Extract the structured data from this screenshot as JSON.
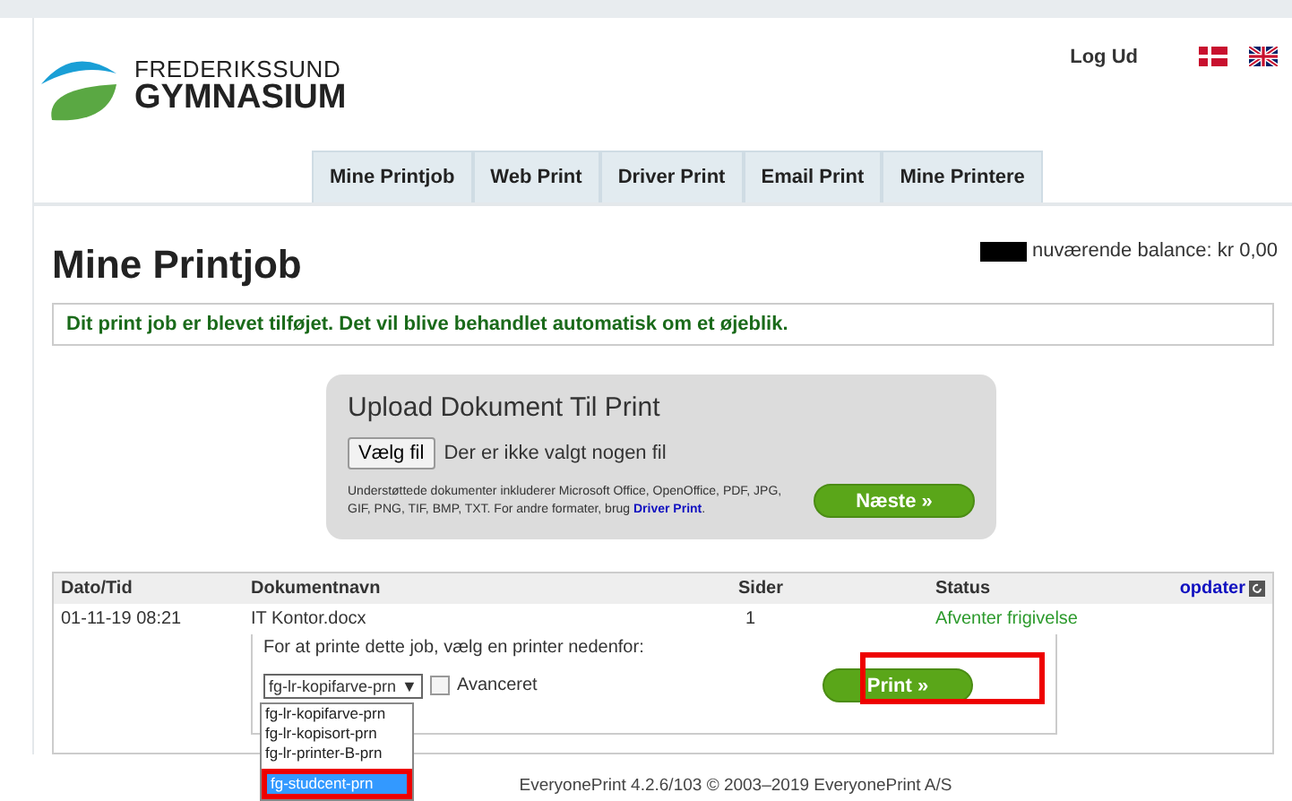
{
  "header": {
    "logo_line_1": "FREDERIKSSUND",
    "logo_line_2": "GYMNASIUM",
    "logout": "Log Ud"
  },
  "tabs": [
    {
      "label": "Mine Printjob"
    },
    {
      "label": "Web Print"
    },
    {
      "label": "Driver Print"
    },
    {
      "label": "Email Print"
    },
    {
      "label": "Mine Printere"
    }
  ],
  "page_title": "Mine Printjob",
  "balance": "nuværende balance: kr 0,00",
  "message": "Dit print job er blevet tilføjet. Det vil blive behandlet automatisk om et øjeblik.",
  "upload": {
    "title": "Upload Dokument Til Print",
    "file_button": "Vælg fil",
    "file_status": "Der er ikke valgt nogen fil",
    "note": "Understøttede dokumenter inkluderer Microsoft Office, OpenOffice, PDF, JPG, GIF, PNG, TIF, BMP, TXT. For andre formater, brug ",
    "note_link": "Driver Print",
    "note_end": ".",
    "next_button": "Næste »"
  },
  "table": {
    "columns": [
      "Dato/Tid",
      "Dokumentnavn",
      "Sider",
      "Status"
    ],
    "refresh": "opdater",
    "rows": [
      {
        "date": "01-11-19 08:21",
        "name": "IT Kontor.docx",
        "pages": "1",
        "status": "Afventer frigivelse"
      }
    ]
  },
  "printer_panel": {
    "prompt": "For at printe dette job, vælg en printer nedenfor:",
    "select_value": "fg-lr-kopifarve-prn",
    "select_arrow": "▼",
    "advanced": {
      "label": "Avanceret",
      "checked": false
    },
    "print_button": "Print »",
    "options": [
      {
        "label": "fg-lr-kopifarve-prn",
        "selected": false
      },
      {
        "label": "fg-lr-kopisort-prn",
        "selected": false
      },
      {
        "label": "fg-lr-printer-B-prn",
        "selected": false
      },
      {
        "label": "fg-studcent-prn",
        "selected": true
      }
    ]
  },
  "footer": "EveryonePrint 4.2.6/103 © 2003–2019 EveryonePrint A/S"
}
